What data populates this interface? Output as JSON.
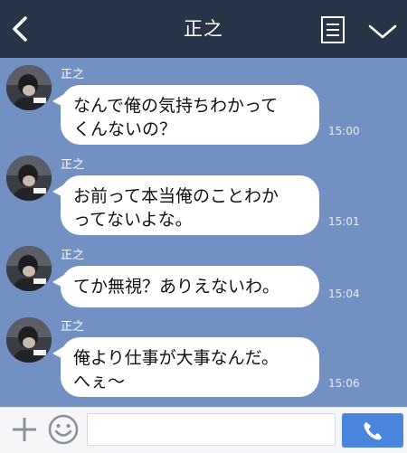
{
  "header": {
    "title": "正之",
    "back_icon": "chevron-left-icon",
    "notes_icon": "notes-icon",
    "menu_icon": "chevron-down-icon",
    "background": "#283549"
  },
  "messages": [
    {
      "sender": "正之",
      "line1": "なんで俺の気持ちわかって",
      "line2": "くんないの？",
      "time": "15:00"
    },
    {
      "sender": "正之",
      "line1": "お前って本当俺のことわか",
      "line2": "ってないよな。",
      "time": "15:01"
    },
    {
      "sender": "正之",
      "line1": "てか無視？ありえないわ。",
      "line2": "",
      "time": "15:04"
    },
    {
      "sender": "正之",
      "line1": "俺より仕事が大事なんだ。",
      "line2": "へぇ〜",
      "time": "15:06"
    }
  ],
  "input_bar": {
    "add_icon": "plus-icon",
    "emoji_icon": "smiley-icon",
    "text_value": "",
    "call_icon": "phone-icon",
    "send_color": "#4a86dd"
  },
  "colors": {
    "chat_background": "#7291c3",
    "bubble": "#ffffff"
  }
}
